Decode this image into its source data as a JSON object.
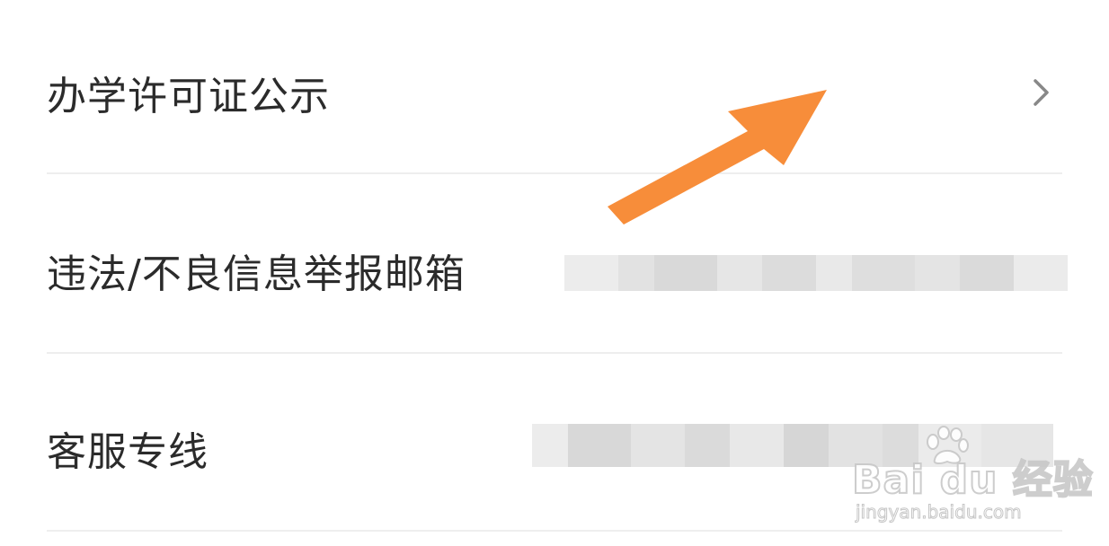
{
  "settings_list": {
    "items": [
      {
        "label": "办学许可证公示",
        "has_chevron": true
      },
      {
        "label": "违法/不良信息举报邮箱",
        "value": ""
      },
      {
        "label": "客服专线",
        "value": ""
      }
    ]
  },
  "annotation": {
    "arrow_color": "#f78d3a",
    "icon": "pointer-arrow"
  },
  "watermark": {
    "brand_text": "Bai du 经验",
    "url_text": "jingyan.baidu.com"
  },
  "colors": {
    "text": "#2b2b2b",
    "divider": "#eeeeee",
    "chevron": "#888888"
  }
}
